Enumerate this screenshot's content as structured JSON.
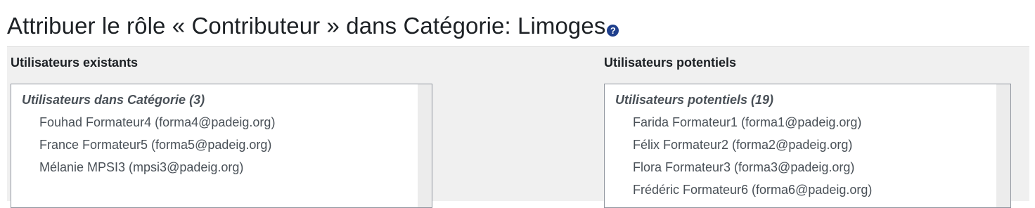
{
  "page": {
    "title": "Attribuer le rôle « Contributeur » dans Catégorie: Limoges",
    "help_icon": "question-circle-icon",
    "help_icon_glyph": "?",
    "help_icon_color": "#1f3f8c"
  },
  "existing": {
    "heading": "Utilisateurs existants",
    "group_label": "Utilisateurs dans Catégorie (3)",
    "users": [
      "Fouhad Formateur4 (forma4@padeig.org)",
      "France Formateur5 (forma5@padeig.org)",
      "Mélanie MPSI3 (mpsi3@padeig.org)"
    ]
  },
  "potential": {
    "heading": "Utilisateurs potentiels",
    "group_label": "Utilisateurs potentiels (19)",
    "users": [
      "Farida Formateur1 (forma1@padeig.org)",
      "Félix Formateur2 (forma2@padeig.org)",
      "Flora Formateur3 (forma3@padeig.org)",
      "Frédéric Formateur6 (forma6@padeig.org)"
    ]
  }
}
